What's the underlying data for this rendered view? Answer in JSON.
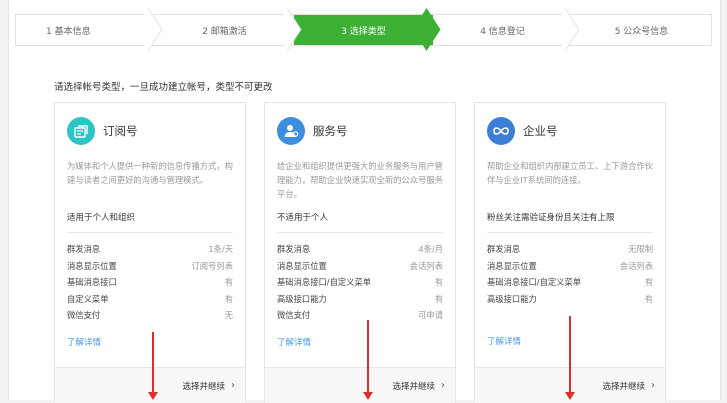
{
  "steps": [
    {
      "label": "1 基本信息",
      "active": false
    },
    {
      "label": "2 邮箱激活",
      "active": false
    },
    {
      "label": "3 选择类型",
      "active": true
    },
    {
      "label": "4 信息登记",
      "active": false
    },
    {
      "label": "5 公众号信息",
      "active": false
    }
  ],
  "intro": "请选择帐号类型，一旦成功建立帐号，类型不可更改",
  "colors": {
    "step_active": "#3cb034",
    "link": "#459ae9",
    "arrow": "#d9302b"
  },
  "cards": [
    {
      "icon": "subscription-icon",
      "icon_color": "#2fc4c4",
      "title": "订阅号",
      "desc": "为媒体和个人提供一种新的信息传播方式，构建与读者之间更好的沟通与管理模式。",
      "scope": "适用于个人和组织",
      "features": [
        {
          "k": "群发消息",
          "v": "1条/天"
        },
        {
          "k": "消息显示位置",
          "v": "订阅号列表"
        },
        {
          "k": "基础消息接口",
          "v": "有"
        },
        {
          "k": "自定义菜单",
          "v": "有"
        },
        {
          "k": "微信支付",
          "v": "无"
        }
      ],
      "more": "了解详情",
      "cta": "选择并继续"
    },
    {
      "icon": "service-icon",
      "icon_color": "#3d8ee0",
      "title": "服务号",
      "desc": "给企业和组织提供更强大的业务服务与用户管理能力，帮助企业快速实现全新的公众号服务平台。",
      "scope": "不适用于个人",
      "features": [
        {
          "k": "群发消息",
          "v": "4条/月"
        },
        {
          "k": "消息显示位置",
          "v": "会话列表"
        },
        {
          "k": "基础消息接口/自定义菜单",
          "v": "有"
        },
        {
          "k": "高级接口能力",
          "v": "有"
        },
        {
          "k": "微信支付",
          "v": "可申请"
        }
      ],
      "more": "了解详情",
      "cta": "选择并继续"
    },
    {
      "icon": "enterprise-icon",
      "icon_color": "#3b7fd6",
      "title": "企业号",
      "desc": "帮助企业和组织内部建立员工、上下游合作伙伴与企业IT系统间的连接。",
      "scope": "粉丝关注需验证身份且关注有上限",
      "features": [
        {
          "k": "群发消息",
          "v": "无限制"
        },
        {
          "k": "消息显示位置",
          "v": "会话列表"
        },
        {
          "k": "基础消息接口/自定义菜单",
          "v": "有"
        },
        {
          "k": "高级接口能力",
          "v": "有"
        }
      ],
      "more": "了解详情",
      "cta": "选择并继续"
    }
  ]
}
